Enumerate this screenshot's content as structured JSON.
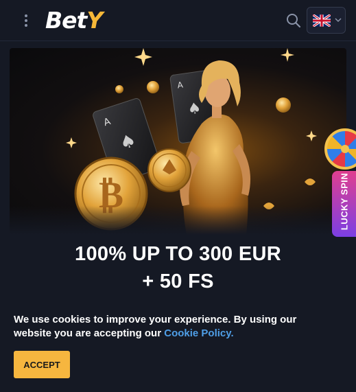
{
  "header": {
    "logo_main": "Bet",
    "logo_accent": "Y",
    "menu_icon": "kebab-menu-icon",
    "search_icon": "search-icon",
    "language_flag": "uk-flag-icon",
    "language_chevron": "chevron-down-icon"
  },
  "banner": {
    "promo_line1": "100% UP TO 300 EUR",
    "promo_line2": "+ 50 FS"
  },
  "lucky_spin": {
    "label": "LUCKY SPIN",
    "icon": "fortune-wheel-icon"
  },
  "cookie_notice": {
    "text": "We use cookies to improve your experience. By using our website you are accepting our ",
    "link_text": "Cookie Policy.",
    "accept_label": "ACCEPT"
  },
  "colors": {
    "background": "#151924",
    "accent": "#f6b63f",
    "link": "#4f9fe8"
  }
}
